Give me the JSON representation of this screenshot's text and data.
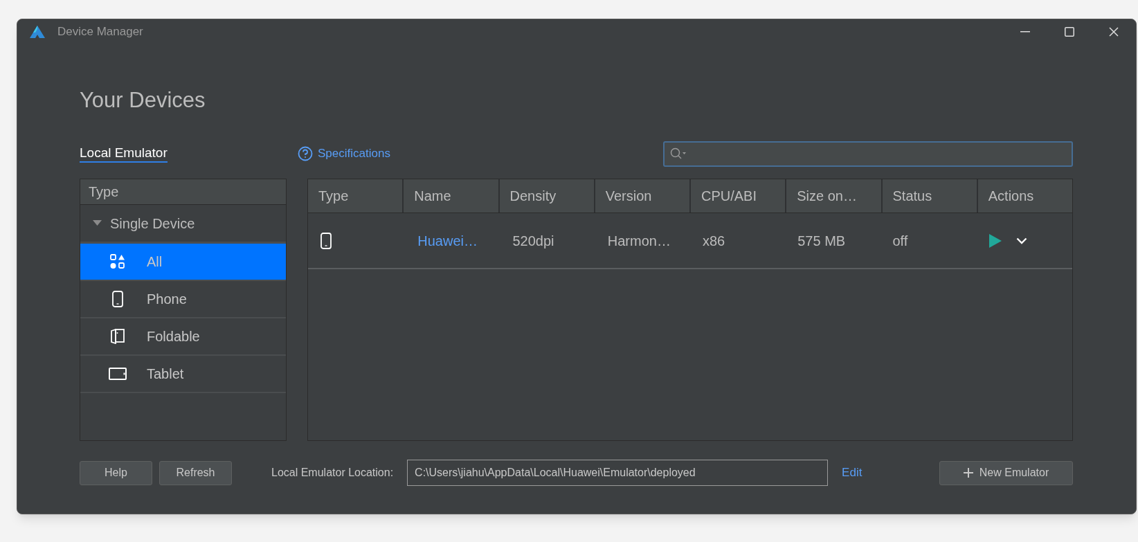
{
  "window": {
    "title": "Device Manager"
  },
  "heading": "Your Devices",
  "tabs": [
    {
      "label": "Local Emulator",
      "selected": true
    }
  ],
  "specifications_link": "Specifications",
  "sidebar": {
    "header": "Type",
    "groups": [
      {
        "label": "Single Device",
        "expanded": true,
        "children": [
          {
            "label": "All",
            "kind": "all",
            "selected": true
          },
          {
            "label": "Phone",
            "kind": "phone",
            "selected": false
          },
          {
            "label": "Foldable",
            "kind": "foldable",
            "selected": false
          },
          {
            "label": "Tablet",
            "kind": "tablet",
            "selected": false
          }
        ]
      }
    ]
  },
  "table": {
    "columns": [
      "Type",
      "Name",
      "Density",
      "Version",
      "CPU/ABI",
      "Size on…",
      "Status",
      "Actions"
    ],
    "rows": [
      {
        "kind": "phone",
        "name": "Huawei…",
        "density": "520dpi",
        "version": "Harmon…",
        "cpu_abi": "x86",
        "size": "575 MB",
        "status": "off"
      }
    ]
  },
  "footer": {
    "buttons": [
      "Help",
      "Refresh"
    ],
    "location_label": "Local Emulator Location:",
    "location_value": "C:\\Users\\jiahu\\AppData\\Local\\Huawei\\Emulator\\deployed",
    "edit_link": "Edit",
    "new_button": "New Emulator"
  }
}
